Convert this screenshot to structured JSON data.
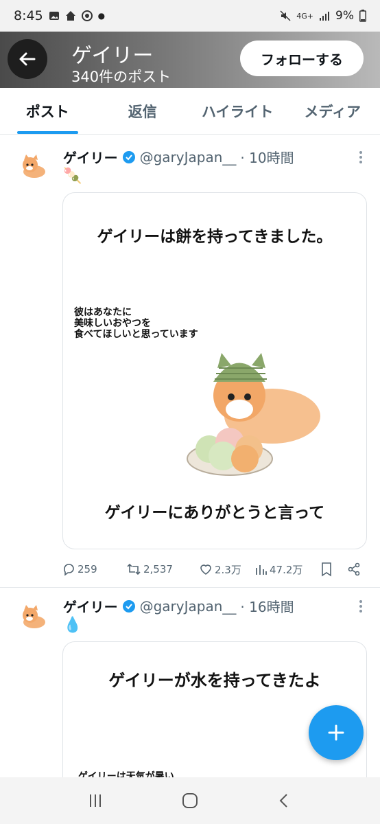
{
  "status_bar": {
    "time": "8:45",
    "network": "4G+",
    "battery": "9%"
  },
  "header": {
    "name": "ゲイリー",
    "post_count": "340件のポスト",
    "follow_label": "フォローする"
  },
  "tabs": [
    {
      "label": "ポスト",
      "active": true
    },
    {
      "label": "返信",
      "active": false
    },
    {
      "label": "ハイライト",
      "active": false
    },
    {
      "label": "メディア",
      "active": false
    }
  ],
  "tweets": [
    {
      "name": "ゲイリー",
      "handle": "@garyJapan__",
      "time": "· 10時間",
      "emoji": "🍡",
      "card_title": "ゲイリーは餅を持ってきました。",
      "card_note": "彼はあなたに\n美味しいおやつを\n食べてほしいと思っています",
      "card_bottom": "ゲイリーにありがとうと言って",
      "stats": {
        "replies": "259",
        "reposts": "2,537",
        "likes": "2.3万",
        "views": "47.2万"
      }
    },
    {
      "name": "ゲイリー",
      "handle": "@garyJapan__",
      "time": "· 16時間",
      "emoji": "💧",
      "card_title": "ゲイリーが水を持ってきたよ",
      "card_note": "ゲイリーは天気が暑い"
    }
  ],
  "colors": {
    "accent": "#1d9bf0",
    "text": "#0f1419",
    "muted": "#536471"
  }
}
